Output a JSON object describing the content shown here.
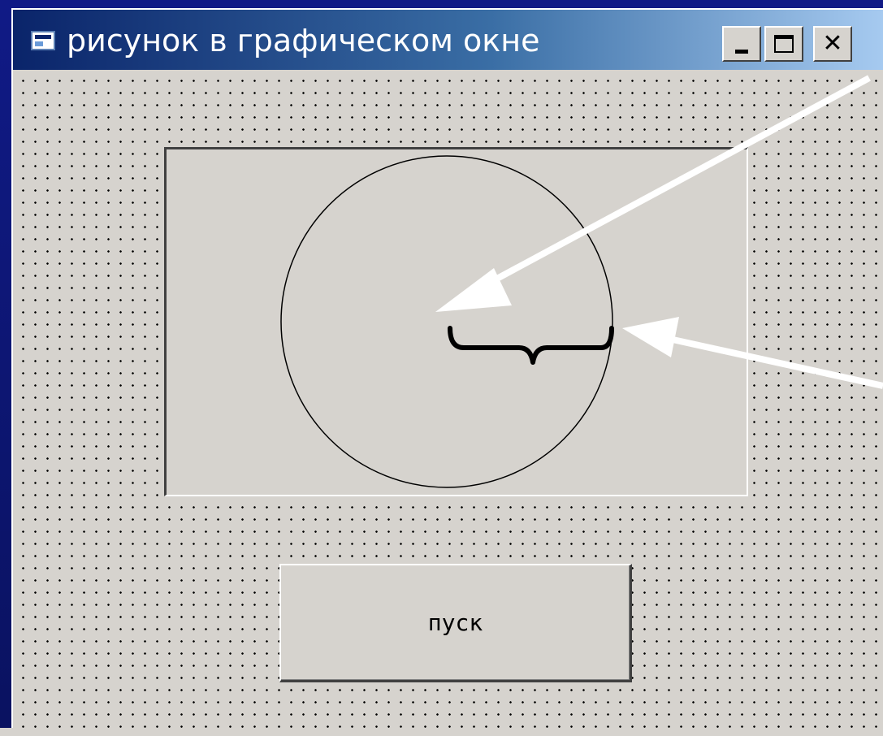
{
  "window": {
    "title": "рисунок в графическом окне",
    "buttons": {
      "minimize_icon": "minimize-icon",
      "maximize_icon": "maximize-icon",
      "close_glyph": "✕"
    }
  },
  "start_button": {
    "label": "пуск"
  },
  "colors": {
    "form_face": "#d6d3ce",
    "titlebar_start": "#0a246a",
    "titlebar_end": "#a6caf0",
    "arrow": "#ffffff"
  }
}
